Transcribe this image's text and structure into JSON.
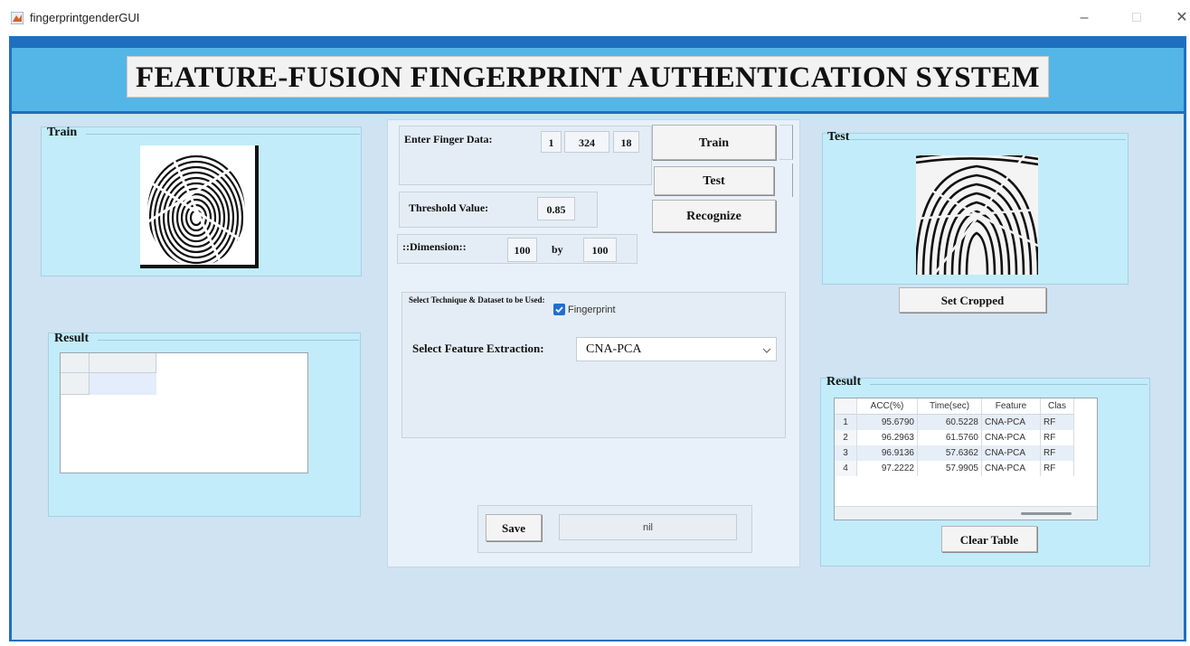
{
  "window": {
    "title": "fingerprintgenderGUI",
    "controls": {
      "minimize": "–",
      "maximize": "□",
      "close": "✕"
    }
  },
  "header": {
    "title": "FEATURE-FUSION FINGERPRINT AUTHENTICATION SYSTEM"
  },
  "train_panel": {
    "title": "Train"
  },
  "result_left": {
    "title": "Result"
  },
  "center": {
    "finger_data": {
      "label": "Enter Finger Data:",
      "values": [
        "1",
        "324",
        "18"
      ]
    },
    "threshold": {
      "label": "Threshold Value:",
      "value": "0.85"
    },
    "dimension": {
      "label": "::Dimension::",
      "width": "100",
      "by": "by",
      "height": "100"
    },
    "buttons": {
      "train": "Train",
      "test": "Test",
      "recognize": "Recognize"
    },
    "technique": {
      "title": "Select Technique & Dataset to be Used:",
      "checkbox_label": "Fingerprint",
      "checkbox_checked": true,
      "feature_label": "Select Feature Extraction:",
      "feature_selected": "CNA-PCA"
    },
    "save": {
      "button": "Save",
      "output": "nil"
    }
  },
  "test_panel": {
    "title": "Test",
    "set_cropped": "Set Cropped"
  },
  "result_right": {
    "title": "Result",
    "columns": [
      "",
      "ACC(%)",
      "Time(sec)",
      "Feature",
      "Clas"
    ],
    "rows": [
      {
        "n": "1",
        "acc": "95.6790",
        "time": "60.5228",
        "feature": "CNA-PCA",
        "cls": "RF"
      },
      {
        "n": "2",
        "acc": "96.2963",
        "time": "61.5760",
        "feature": "CNA-PCA",
        "cls": "RF"
      },
      {
        "n": "3",
        "acc": "96.9136",
        "time": "57.6362",
        "feature": "CNA-PCA",
        "cls": "RF"
      },
      {
        "n": "4",
        "acc": "97.2222",
        "time": "57.9905",
        "feature": "CNA-PCA",
        "cls": "RF"
      }
    ],
    "clear_button": "Clear Table"
  },
  "colors": {
    "frame": "#1f6fbf",
    "header": "#54b6e6",
    "panel": "#c2ecfa",
    "content": "#cfe3f3",
    "checkbox": "#1f6fd0"
  }
}
